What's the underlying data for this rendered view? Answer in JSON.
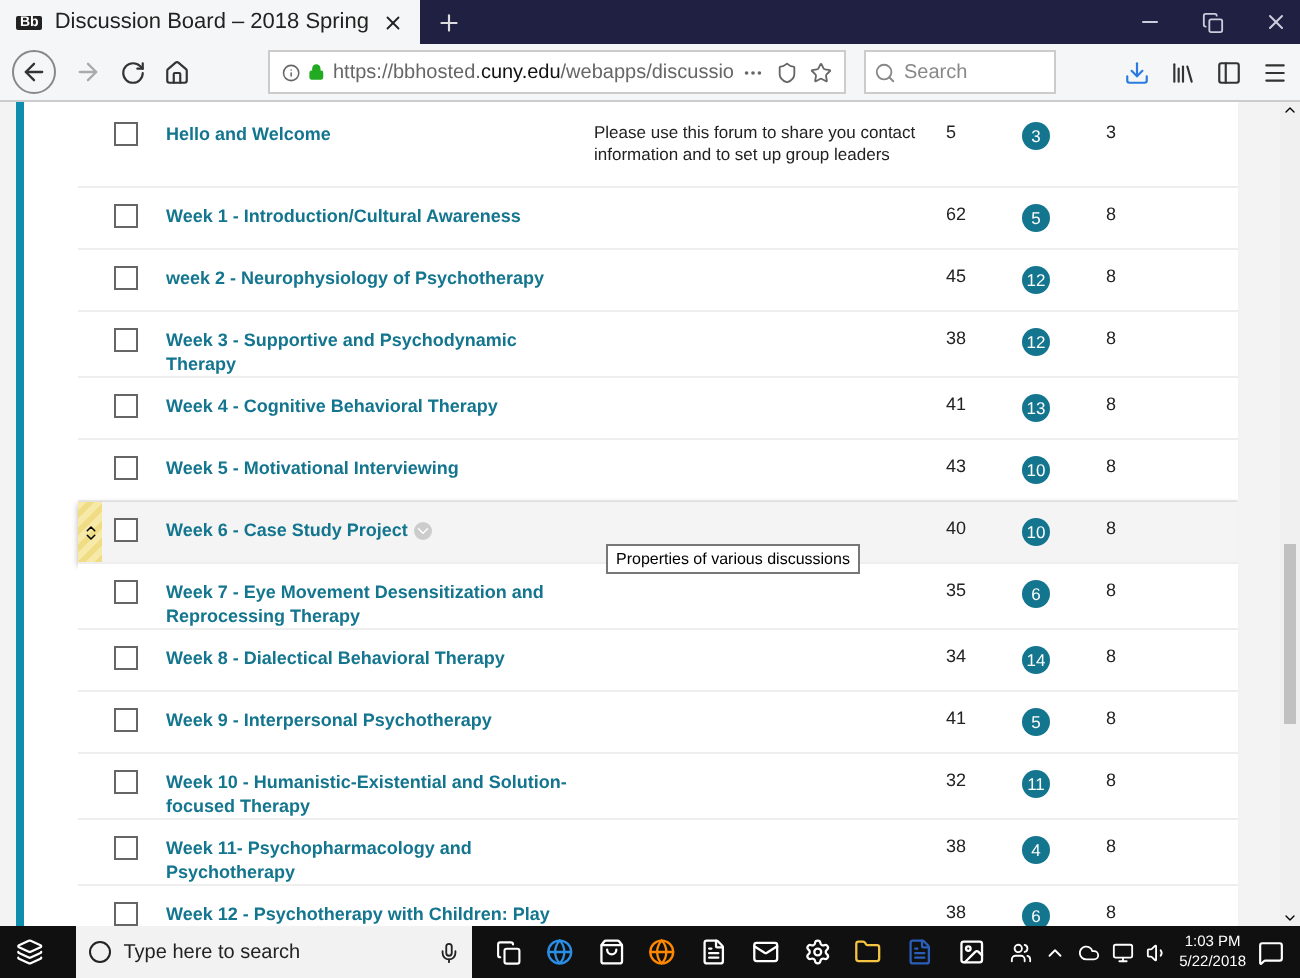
{
  "browser": {
    "tab_title": "Discussion Board – 2018 Spring",
    "tab_favicon": "Bb",
    "url_prefix": "https://bbhosted.",
    "url_domain": "cuny.edu",
    "url_path": "/webapps/discussio",
    "search": {
      "placeholder": "Search"
    }
  },
  "forums": [
    {
      "title": "Hello and Welcome",
      "description": "Please use this forum to share you contact information and to set up group leaders",
      "posts": "5",
      "unread": "3",
      "participants": "3",
      "checked": false,
      "highlighted": false
    },
    {
      "title": "Week 1 - Introduction/Cultural Awareness",
      "posts": "62",
      "unread": "5",
      "participants": "8",
      "checked": false,
      "highlighted": false
    },
    {
      "title": "week 2 - Neurophysiology of Psychotherapy",
      "posts": "45",
      "unread": "12",
      "participants": "8",
      "checked": false,
      "highlighted": false
    },
    {
      "title": "Week 3 - Supportive and Psychodynamic Therapy",
      "posts": "38",
      "unread": "12",
      "participants": "8",
      "checked": false,
      "highlighted": false
    },
    {
      "title": "Week 4 - Cognitive Behavioral Therapy",
      "posts": "41",
      "unread": "13",
      "participants": "8",
      "checked": false,
      "highlighted": false
    },
    {
      "title": "Week 5 - Motivational Interviewing",
      "posts": "43",
      "unread": "10",
      "participants": "8",
      "checked": false,
      "highlighted": false
    },
    {
      "title": "Week 6 - Case Study Project",
      "posts": "40",
      "unread": "10",
      "participants": "8",
      "checked": false,
      "highlighted": true,
      "tooltip": "Properties of various discussions"
    },
    {
      "title": "Week 7 - Eye Movement Desensitization and Reprocessing Therapy",
      "posts": "35",
      "unread": "6",
      "participants": "8",
      "checked": false,
      "highlighted": false
    },
    {
      "title": "Week 8 - Dialectical Behavioral Therapy",
      "posts": "34",
      "unread": "14",
      "participants": "8",
      "checked": false,
      "highlighted": false
    },
    {
      "title": "Week 9 - Interpersonal Psychotherapy",
      "posts": "41",
      "unread": "5",
      "participants": "8",
      "checked": false,
      "highlighted": false
    },
    {
      "title": "Week 10 - Humanistic-Existential and Solution-focused Therapy",
      "posts": "32",
      "unread": "11",
      "participants": "8",
      "checked": false,
      "highlighted": false
    },
    {
      "title": "Week 11- Psychopharmacology and Psychotherapy",
      "posts": "38",
      "unread": "4",
      "participants": "8",
      "checked": false,
      "highlighted": false
    },
    {
      "title": "Week 12 - Psychotherapy with Children: Play",
      "posts": "38",
      "unread": "6",
      "participants": "8",
      "checked": false,
      "highlighted": false
    }
  ],
  "taskbar": {
    "search": {
      "placeholder": "Type here to search"
    },
    "time": "1:03 PM",
    "date": "5/22/2018"
  }
}
